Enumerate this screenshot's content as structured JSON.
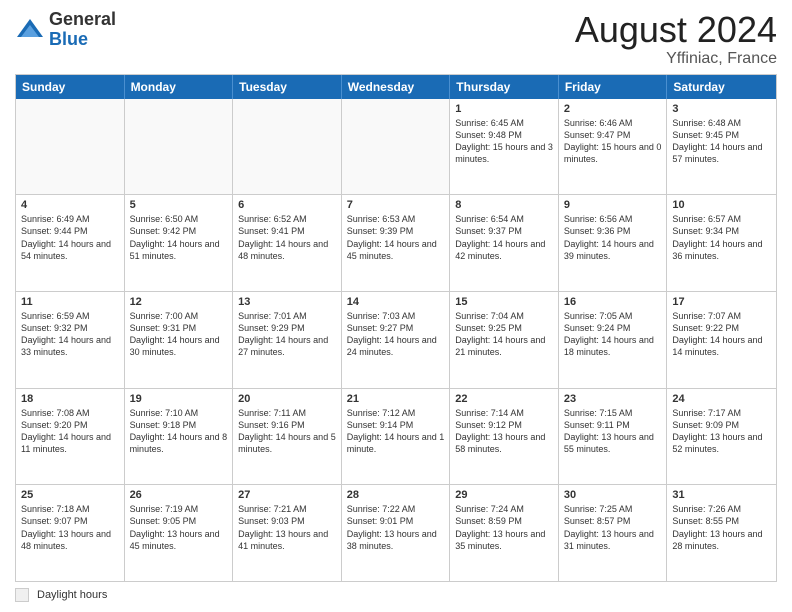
{
  "logo": {
    "general": "General",
    "blue": "Blue"
  },
  "title": {
    "month_year": "August 2024",
    "location": "Yffiniac, France"
  },
  "header_days": [
    "Sunday",
    "Monday",
    "Tuesday",
    "Wednesday",
    "Thursday",
    "Friday",
    "Saturday"
  ],
  "weeks": [
    [
      {
        "day": "",
        "sunrise": "",
        "sunset": "",
        "daylight": "",
        "empty": true
      },
      {
        "day": "",
        "sunrise": "",
        "sunset": "",
        "daylight": "",
        "empty": true
      },
      {
        "day": "",
        "sunrise": "",
        "sunset": "",
        "daylight": "",
        "empty": true
      },
      {
        "day": "",
        "sunrise": "",
        "sunset": "",
        "daylight": "",
        "empty": true
      },
      {
        "day": "1",
        "sunrise": "Sunrise: 6:45 AM",
        "sunset": "Sunset: 9:48 PM",
        "daylight": "Daylight: 15 hours and 3 minutes."
      },
      {
        "day": "2",
        "sunrise": "Sunrise: 6:46 AM",
        "sunset": "Sunset: 9:47 PM",
        "daylight": "Daylight: 15 hours and 0 minutes."
      },
      {
        "day": "3",
        "sunrise": "Sunrise: 6:48 AM",
        "sunset": "Sunset: 9:45 PM",
        "daylight": "Daylight: 14 hours and 57 minutes."
      }
    ],
    [
      {
        "day": "4",
        "sunrise": "Sunrise: 6:49 AM",
        "sunset": "Sunset: 9:44 PM",
        "daylight": "Daylight: 14 hours and 54 minutes."
      },
      {
        "day": "5",
        "sunrise": "Sunrise: 6:50 AM",
        "sunset": "Sunset: 9:42 PM",
        "daylight": "Daylight: 14 hours and 51 minutes."
      },
      {
        "day": "6",
        "sunrise": "Sunrise: 6:52 AM",
        "sunset": "Sunset: 9:41 PM",
        "daylight": "Daylight: 14 hours and 48 minutes."
      },
      {
        "day": "7",
        "sunrise": "Sunrise: 6:53 AM",
        "sunset": "Sunset: 9:39 PM",
        "daylight": "Daylight: 14 hours and 45 minutes."
      },
      {
        "day": "8",
        "sunrise": "Sunrise: 6:54 AM",
        "sunset": "Sunset: 9:37 PM",
        "daylight": "Daylight: 14 hours and 42 minutes."
      },
      {
        "day": "9",
        "sunrise": "Sunrise: 6:56 AM",
        "sunset": "Sunset: 9:36 PM",
        "daylight": "Daylight: 14 hours and 39 minutes."
      },
      {
        "day": "10",
        "sunrise": "Sunrise: 6:57 AM",
        "sunset": "Sunset: 9:34 PM",
        "daylight": "Daylight: 14 hours and 36 minutes."
      }
    ],
    [
      {
        "day": "11",
        "sunrise": "Sunrise: 6:59 AM",
        "sunset": "Sunset: 9:32 PM",
        "daylight": "Daylight: 14 hours and 33 minutes."
      },
      {
        "day": "12",
        "sunrise": "Sunrise: 7:00 AM",
        "sunset": "Sunset: 9:31 PM",
        "daylight": "Daylight: 14 hours and 30 minutes."
      },
      {
        "day": "13",
        "sunrise": "Sunrise: 7:01 AM",
        "sunset": "Sunset: 9:29 PM",
        "daylight": "Daylight: 14 hours and 27 minutes."
      },
      {
        "day": "14",
        "sunrise": "Sunrise: 7:03 AM",
        "sunset": "Sunset: 9:27 PM",
        "daylight": "Daylight: 14 hours and 24 minutes."
      },
      {
        "day": "15",
        "sunrise": "Sunrise: 7:04 AM",
        "sunset": "Sunset: 9:25 PM",
        "daylight": "Daylight: 14 hours and 21 minutes."
      },
      {
        "day": "16",
        "sunrise": "Sunrise: 7:05 AM",
        "sunset": "Sunset: 9:24 PM",
        "daylight": "Daylight: 14 hours and 18 minutes."
      },
      {
        "day": "17",
        "sunrise": "Sunrise: 7:07 AM",
        "sunset": "Sunset: 9:22 PM",
        "daylight": "Daylight: 14 hours and 14 minutes."
      }
    ],
    [
      {
        "day": "18",
        "sunrise": "Sunrise: 7:08 AM",
        "sunset": "Sunset: 9:20 PM",
        "daylight": "Daylight: 14 hours and 11 minutes."
      },
      {
        "day": "19",
        "sunrise": "Sunrise: 7:10 AM",
        "sunset": "Sunset: 9:18 PM",
        "daylight": "Daylight: 14 hours and 8 minutes."
      },
      {
        "day": "20",
        "sunrise": "Sunrise: 7:11 AM",
        "sunset": "Sunset: 9:16 PM",
        "daylight": "Daylight: 14 hours and 5 minutes."
      },
      {
        "day": "21",
        "sunrise": "Sunrise: 7:12 AM",
        "sunset": "Sunset: 9:14 PM",
        "daylight": "Daylight: 14 hours and 1 minute."
      },
      {
        "day": "22",
        "sunrise": "Sunrise: 7:14 AM",
        "sunset": "Sunset: 9:12 PM",
        "daylight": "Daylight: 13 hours and 58 minutes."
      },
      {
        "day": "23",
        "sunrise": "Sunrise: 7:15 AM",
        "sunset": "Sunset: 9:11 PM",
        "daylight": "Daylight: 13 hours and 55 minutes."
      },
      {
        "day": "24",
        "sunrise": "Sunrise: 7:17 AM",
        "sunset": "Sunset: 9:09 PM",
        "daylight": "Daylight: 13 hours and 52 minutes."
      }
    ],
    [
      {
        "day": "25",
        "sunrise": "Sunrise: 7:18 AM",
        "sunset": "Sunset: 9:07 PM",
        "daylight": "Daylight: 13 hours and 48 minutes."
      },
      {
        "day": "26",
        "sunrise": "Sunrise: 7:19 AM",
        "sunset": "Sunset: 9:05 PM",
        "daylight": "Daylight: 13 hours and 45 minutes."
      },
      {
        "day": "27",
        "sunrise": "Sunrise: 7:21 AM",
        "sunset": "Sunset: 9:03 PM",
        "daylight": "Daylight: 13 hours and 41 minutes."
      },
      {
        "day": "28",
        "sunrise": "Sunrise: 7:22 AM",
        "sunset": "Sunset: 9:01 PM",
        "daylight": "Daylight: 13 hours and 38 minutes."
      },
      {
        "day": "29",
        "sunrise": "Sunrise: 7:24 AM",
        "sunset": "Sunset: 8:59 PM",
        "daylight": "Daylight: 13 hours and 35 minutes."
      },
      {
        "day": "30",
        "sunrise": "Sunrise: 7:25 AM",
        "sunset": "Sunset: 8:57 PM",
        "daylight": "Daylight: 13 hours and 31 minutes."
      },
      {
        "day": "31",
        "sunrise": "Sunrise: 7:26 AM",
        "sunset": "Sunset: 8:55 PM",
        "daylight": "Daylight: 13 hours and 28 minutes."
      }
    ]
  ],
  "footer": {
    "legend_label": "Daylight hours"
  }
}
